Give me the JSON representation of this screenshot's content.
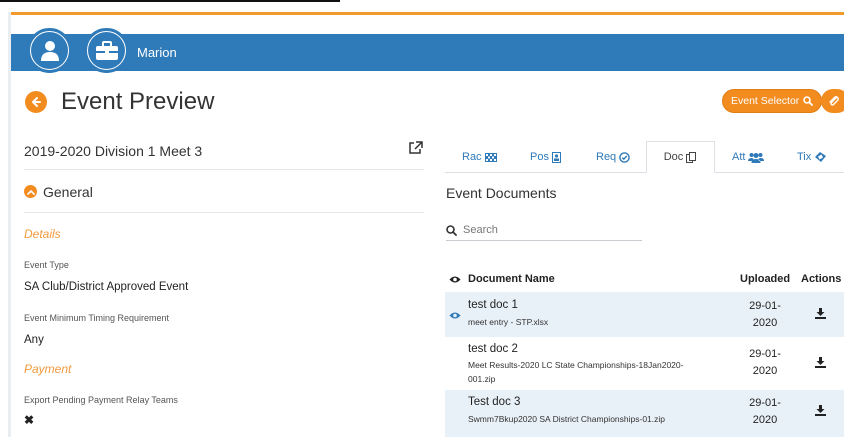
{
  "header": {
    "user_name": "Marion",
    "icons": [
      "user-icon",
      "briefcase-icon"
    ],
    "bar_color": "#2f7ab8",
    "accent_color": "#f28c1f"
  },
  "page": {
    "title": "Event Preview",
    "event_selector_label": "Event Selector"
  },
  "event": {
    "name": "2019-2020 Division 1 Meet 3",
    "section_title": "General",
    "details_heading": "Details",
    "event_type_label": "Event Type",
    "event_type_value": "SA Club/District Approved Event",
    "timing_label": "Event Minimum Timing Requirement",
    "timing_value": "Any",
    "payment_heading": "Payment",
    "relay_label": "Export Pending Payment Relay Teams",
    "relay_value": "✖"
  },
  "tabs": [
    {
      "label": "Rac",
      "icon": "flag-icon"
    },
    {
      "label": "Pos",
      "icon": "id-badge-icon"
    },
    {
      "label": "Req",
      "icon": "check-circle-icon"
    },
    {
      "label": "Doc",
      "icon": "copy-icon"
    },
    {
      "label": "Att",
      "icon": "users-icon"
    },
    {
      "label": "Tix",
      "icon": "ticket-icon"
    }
  ],
  "active_tab": "Doc",
  "documents": {
    "title": "Event Documents",
    "search_placeholder": "Search",
    "columns": {
      "name": "Document Name",
      "uploaded": "Uploaded",
      "actions": "Actions"
    },
    "rows": [
      {
        "name": "test doc 1",
        "file": "meet entry - STP.xlsx",
        "date_line1": "29-01-",
        "date_line2": "2020"
      },
      {
        "name": "test doc 2",
        "file_line1": "Meet Results-2020 LC State Championships-18Jan2020-",
        "file_line2": "001.zip",
        "date_line1": "29-01-",
        "date_line2": "2020"
      },
      {
        "name": "Test doc 3",
        "file": "Swmm7Bkup2020 SA District Championships-01.zip",
        "date_line1": "29-01-",
        "date_line2": "2020"
      }
    ]
  }
}
